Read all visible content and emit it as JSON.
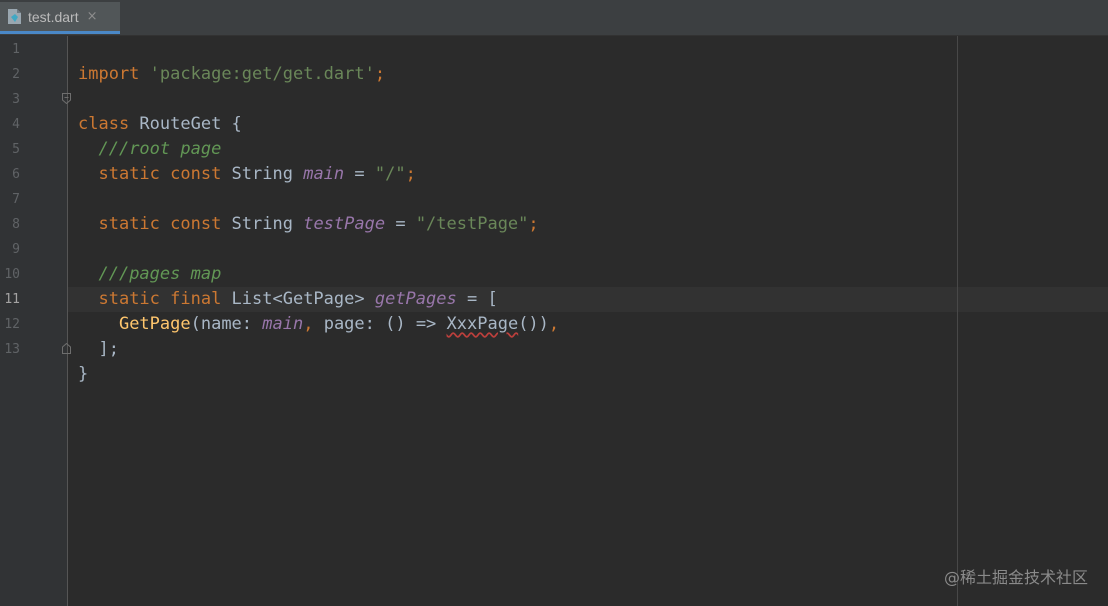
{
  "tab": {
    "label": "test.dart",
    "close": "×",
    "icon": "dart-file-icon"
  },
  "editor": {
    "current_line": 11,
    "lines": [
      {
        "n": "1"
      },
      {
        "n": "2"
      },
      {
        "n": "3"
      },
      {
        "n": "4"
      },
      {
        "n": "5"
      },
      {
        "n": "6"
      },
      {
        "n": "7"
      },
      {
        "n": "8"
      },
      {
        "n": "9"
      },
      {
        "n": "10"
      },
      {
        "n": "11"
      },
      {
        "n": "12"
      },
      {
        "n": "13"
      }
    ],
    "code": {
      "l1_kw": "import",
      "l1_str": "'package:get/get.dart'",
      "l1_end": ";",
      "l3_kw": "class",
      "l3_rest": " RouteGet {",
      "l4_cmt": "///root page",
      "l5_kw": "static const",
      "l5_type": " String ",
      "l5_fld": "main",
      "l5_eq": " = ",
      "l5_str": "\"/\"",
      "l5_end": ";",
      "l7_kw": "static const",
      "l7_type": " String ",
      "l7_fld": "testPage",
      "l7_eq": " = ",
      "l7_str": "\"/testPage\"",
      "l7_end": ";",
      "l9_cmt": "///pages map",
      "l10_kw": "static final",
      "l10_type": " List<GetPage> ",
      "l10_fld": "getPages",
      "l10_rest": " = [",
      "l11_fn": "GetPage",
      "l11_a": "(name: ",
      "l11_fld": "main",
      "l11_b": ", ",
      "l11_c": "page: () => ",
      "l11_typo": "XxxPage",
      "l11_d": "())",
      "l11_end": ",",
      "l12": "];",
      "l13": "}"
    }
  },
  "watermark": "@稀土掘金技术社区",
  "colors": {
    "background": "#2b2b2b",
    "keyword": "#cc7832",
    "string": "#6a8759",
    "comment": "#629755",
    "field": "#9876aa",
    "text": "#a9b7c6",
    "function": "#ffc66d",
    "error_underline": "#bc3f3c"
  }
}
